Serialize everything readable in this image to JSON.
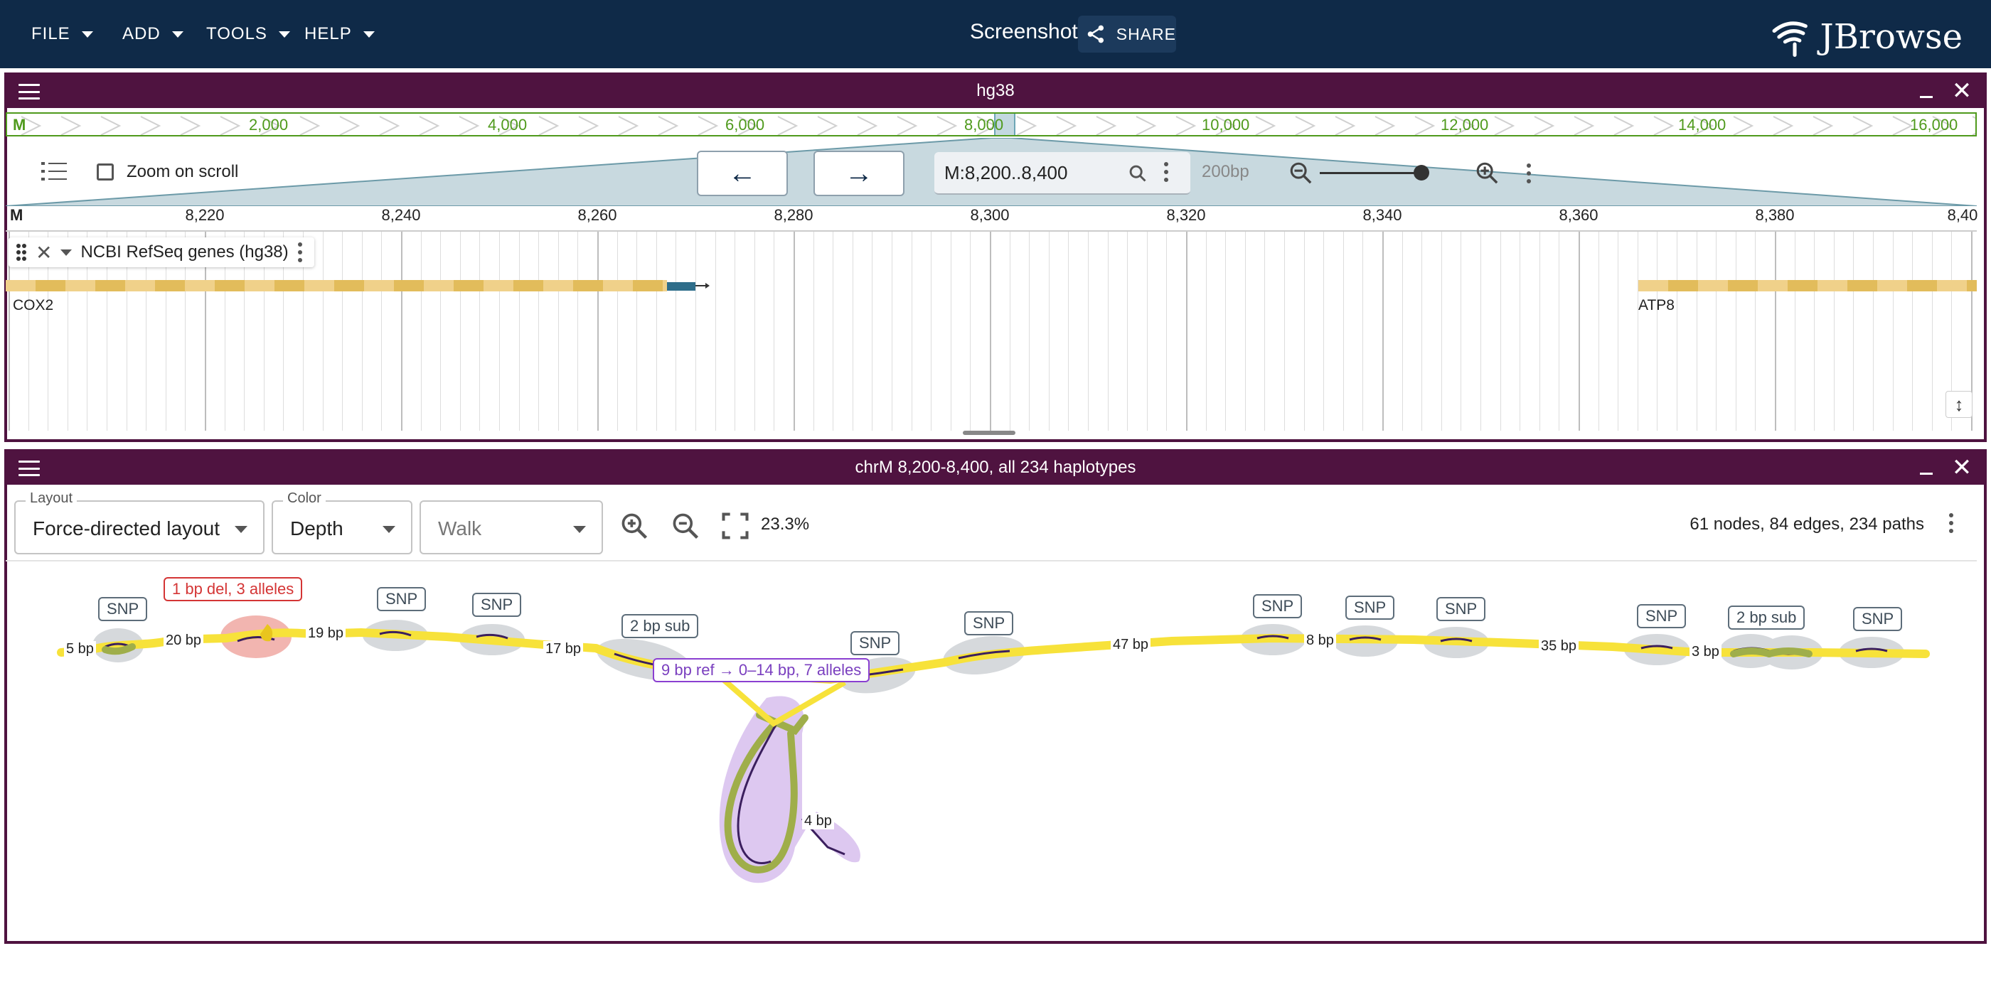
{
  "appbar": {
    "menus": [
      "FILE",
      "ADD",
      "TOOLS",
      "HELP"
    ],
    "session_title": "Screenshot",
    "share_label": "SHARE",
    "logo_text": "JBrowse"
  },
  "linear_view": {
    "title": "hg38",
    "overview": {
      "refname": "M",
      "labels": [
        "2,000",
        "4,000",
        "6,000",
        "8,000",
        "10,000",
        "12,000",
        "14,000",
        "16,000"
      ]
    },
    "zoom_on_scroll_label": "Zoom on scroll",
    "locstring": "M:8,200..8,400",
    "bp_label": "200bp",
    "ruler": {
      "refname": "M",
      "labels": [
        "8,220",
        "8,240",
        "8,260",
        "8,280",
        "8,300",
        "8,320",
        "8,340",
        "8,360",
        "8,380",
        "8,40"
      ]
    },
    "track_name": "NCBI RefSeq genes (hg38)",
    "genes": [
      "COX2",
      "ATP8"
    ]
  },
  "graph_view": {
    "title": "chrM 8,200-8,400, all 234 haplotypes",
    "layout": {
      "legend": "Layout",
      "value": "Force-directed layout"
    },
    "color": {
      "legend": "Color",
      "value": "Depth"
    },
    "walk_placeholder": "Walk",
    "zoom_pct": "23.3%",
    "stats": "61 nodes, 84 edges, 234 paths",
    "annotations": {
      "snp": "SNP",
      "del": "1 bp del, 3 alleles",
      "sub": "2 bp sub",
      "ins": "9 bp ref → 0–14 bp, 7 alleles"
    },
    "bp_labels": [
      "5 bp",
      "20 bp",
      "19 bp",
      "17 bp",
      "47 bp",
      "8 bp",
      "35 bp",
      "3 bp",
      "4 bp"
    ],
    "colors": {
      "path": "#f7e23a",
      "hub": "#9fae4a",
      "snp_halo": "#cfd2d6",
      "del_halo": "#f2b5b0",
      "ins_halo": "#d9c2ee"
    }
  }
}
